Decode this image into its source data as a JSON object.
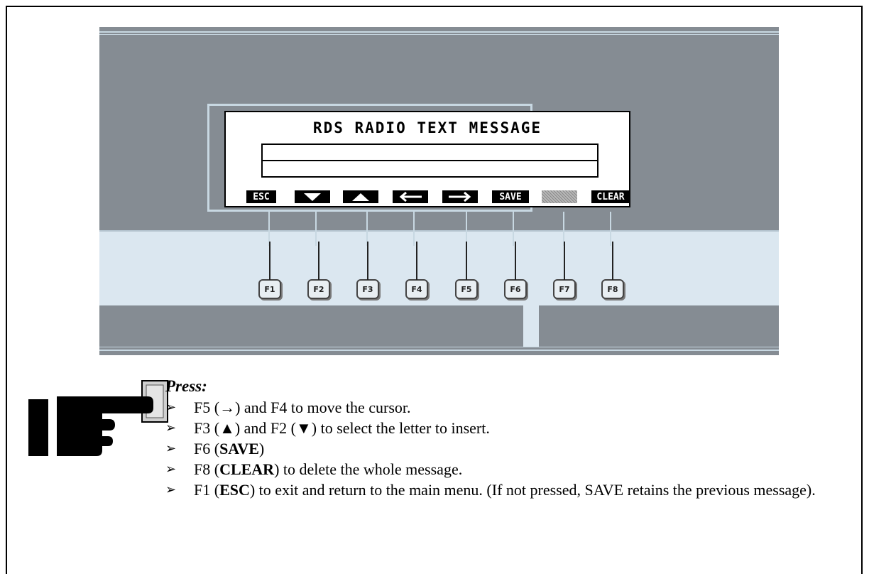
{
  "display": {
    "title": "RDS RADIO TEXT MESSAGE",
    "softkeys": [
      {
        "label": "ESC",
        "icon": null
      },
      {
        "label": "",
        "icon": "triangle-down-icon"
      },
      {
        "label": "",
        "icon": "triangle-up-icon"
      },
      {
        "label": "",
        "icon": "arrow-left-icon"
      },
      {
        "label": "",
        "icon": "arrow-right-icon"
      },
      {
        "label": "SAVE",
        "icon": null
      },
      {
        "label": "",
        "icon": "dithered-blank"
      },
      {
        "label": "CLEAR",
        "icon": null
      }
    ]
  },
  "function_keys": [
    "F1",
    "F2",
    "F3",
    "F4",
    "F5",
    "F6",
    "F7",
    "F8"
  ],
  "instructions": {
    "heading": "Press:",
    "steps": [
      {
        "pre": "F5 (",
        "bold": "→",
        "post": ") and F4 to move the cursor."
      },
      {
        "pre": "F3 (",
        "bold": "▲",
        "post": ") and F2 (▼) to select the letter to insert."
      },
      {
        "pre": "F6 (",
        "bold": "SAVE",
        "post": ")"
      },
      {
        "pre": "F8 (",
        "bold": "CLEAR",
        "post": ") to delete the whole message."
      },
      {
        "pre": "F1 (",
        "bold": "ESC",
        "post": ") to exit and return to the main menu. (If not pressed, SAVE retains the previous message)."
      }
    ]
  },
  "colors": {
    "panel_dark": "#858c93",
    "panel_light": "#dbe7f0",
    "bezel_line": "#c8d8e2"
  }
}
